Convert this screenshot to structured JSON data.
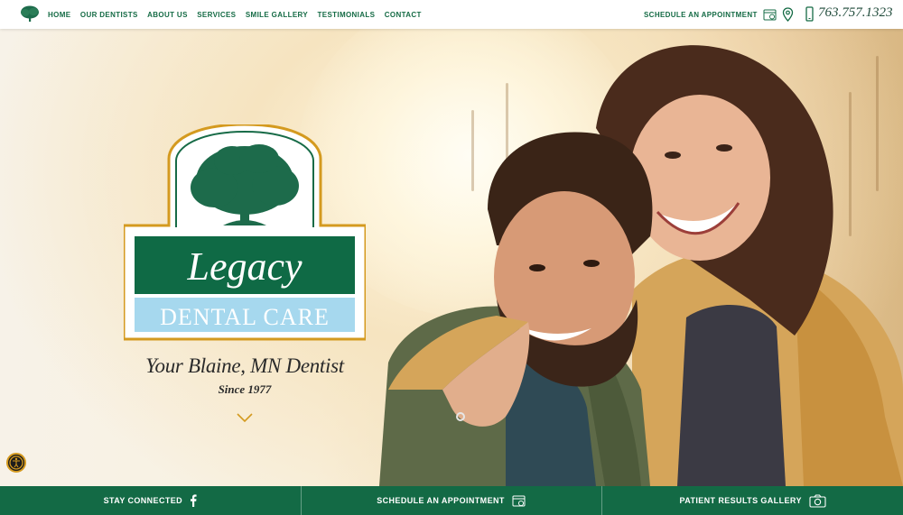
{
  "nav": {
    "items": [
      "HOME",
      "OUR DENTISTS",
      "ABOUT US",
      "SERVICES",
      "SMILE GALLERY",
      "TESTIMONIALS",
      "CONTACT"
    ],
    "schedule_label": "SCHEDULE AN APPOINTMENT",
    "phone": "763.757.1323"
  },
  "hero": {
    "logo_word": "Legacy",
    "logo_subword": "DENTAL CARE",
    "tagline": "Your Blaine, MN Dentist",
    "since": "Since 1977"
  },
  "bottom": {
    "items": [
      "STAY CONNECTED",
      "SCHEDULE AN APPOINTMENT",
      "PATIENT RESULTS GALLERY"
    ]
  },
  "colors": {
    "brand_green": "#136a45",
    "gold": "#d49a1f",
    "light_blue": "#a6d8ee"
  },
  "icons": [
    "tree-logo-icon",
    "calendar-icon",
    "map-pin-icon",
    "phone-icon",
    "chevron-down-icon",
    "accessibility-icon",
    "facebook-icon",
    "camera-icon"
  ]
}
